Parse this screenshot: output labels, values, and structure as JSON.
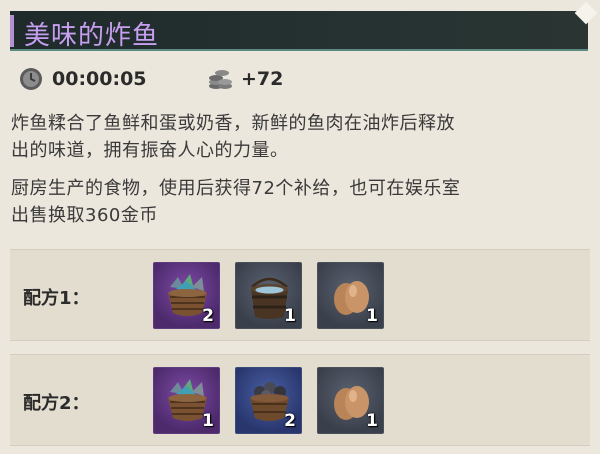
{
  "header": {
    "title": "美味的炸鱼"
  },
  "stats": {
    "time": "00:00:05",
    "supply": "+72"
  },
  "description": {
    "line1": "炸鱼糅合了鱼鲜和蛋或奶香，新鲜的鱼肉在油炸后释放",
    "line2": "出的味道，拥有振奋人心的力量。",
    "line3": "厨房生产的食物，使用后获得72个补给，也可在娱乐室",
    "line4": "出售换取360金币"
  },
  "recipes": [
    {
      "label": "配方1：",
      "items": [
        {
          "icon": "fish-basket-icon",
          "rarity": "purple",
          "count": "2"
        },
        {
          "icon": "water-bucket-icon",
          "rarity": "grey",
          "count": "1"
        },
        {
          "icon": "egg-icon",
          "rarity": "grey",
          "count": "1"
        }
      ]
    },
    {
      "label": "配方2：",
      "items": [
        {
          "icon": "fish-basket-icon",
          "rarity": "purple",
          "count": "1"
        },
        {
          "icon": "shellfish-basket-icon",
          "rarity": "blue",
          "count": "2"
        },
        {
          "icon": "egg-icon",
          "rarity": "grey",
          "count": "1"
        }
      ]
    }
  ],
  "colors": {
    "title": "#c79ff0",
    "purple": "#4c2a6b",
    "blue": "#28366d",
    "grey": "#3a404b"
  }
}
